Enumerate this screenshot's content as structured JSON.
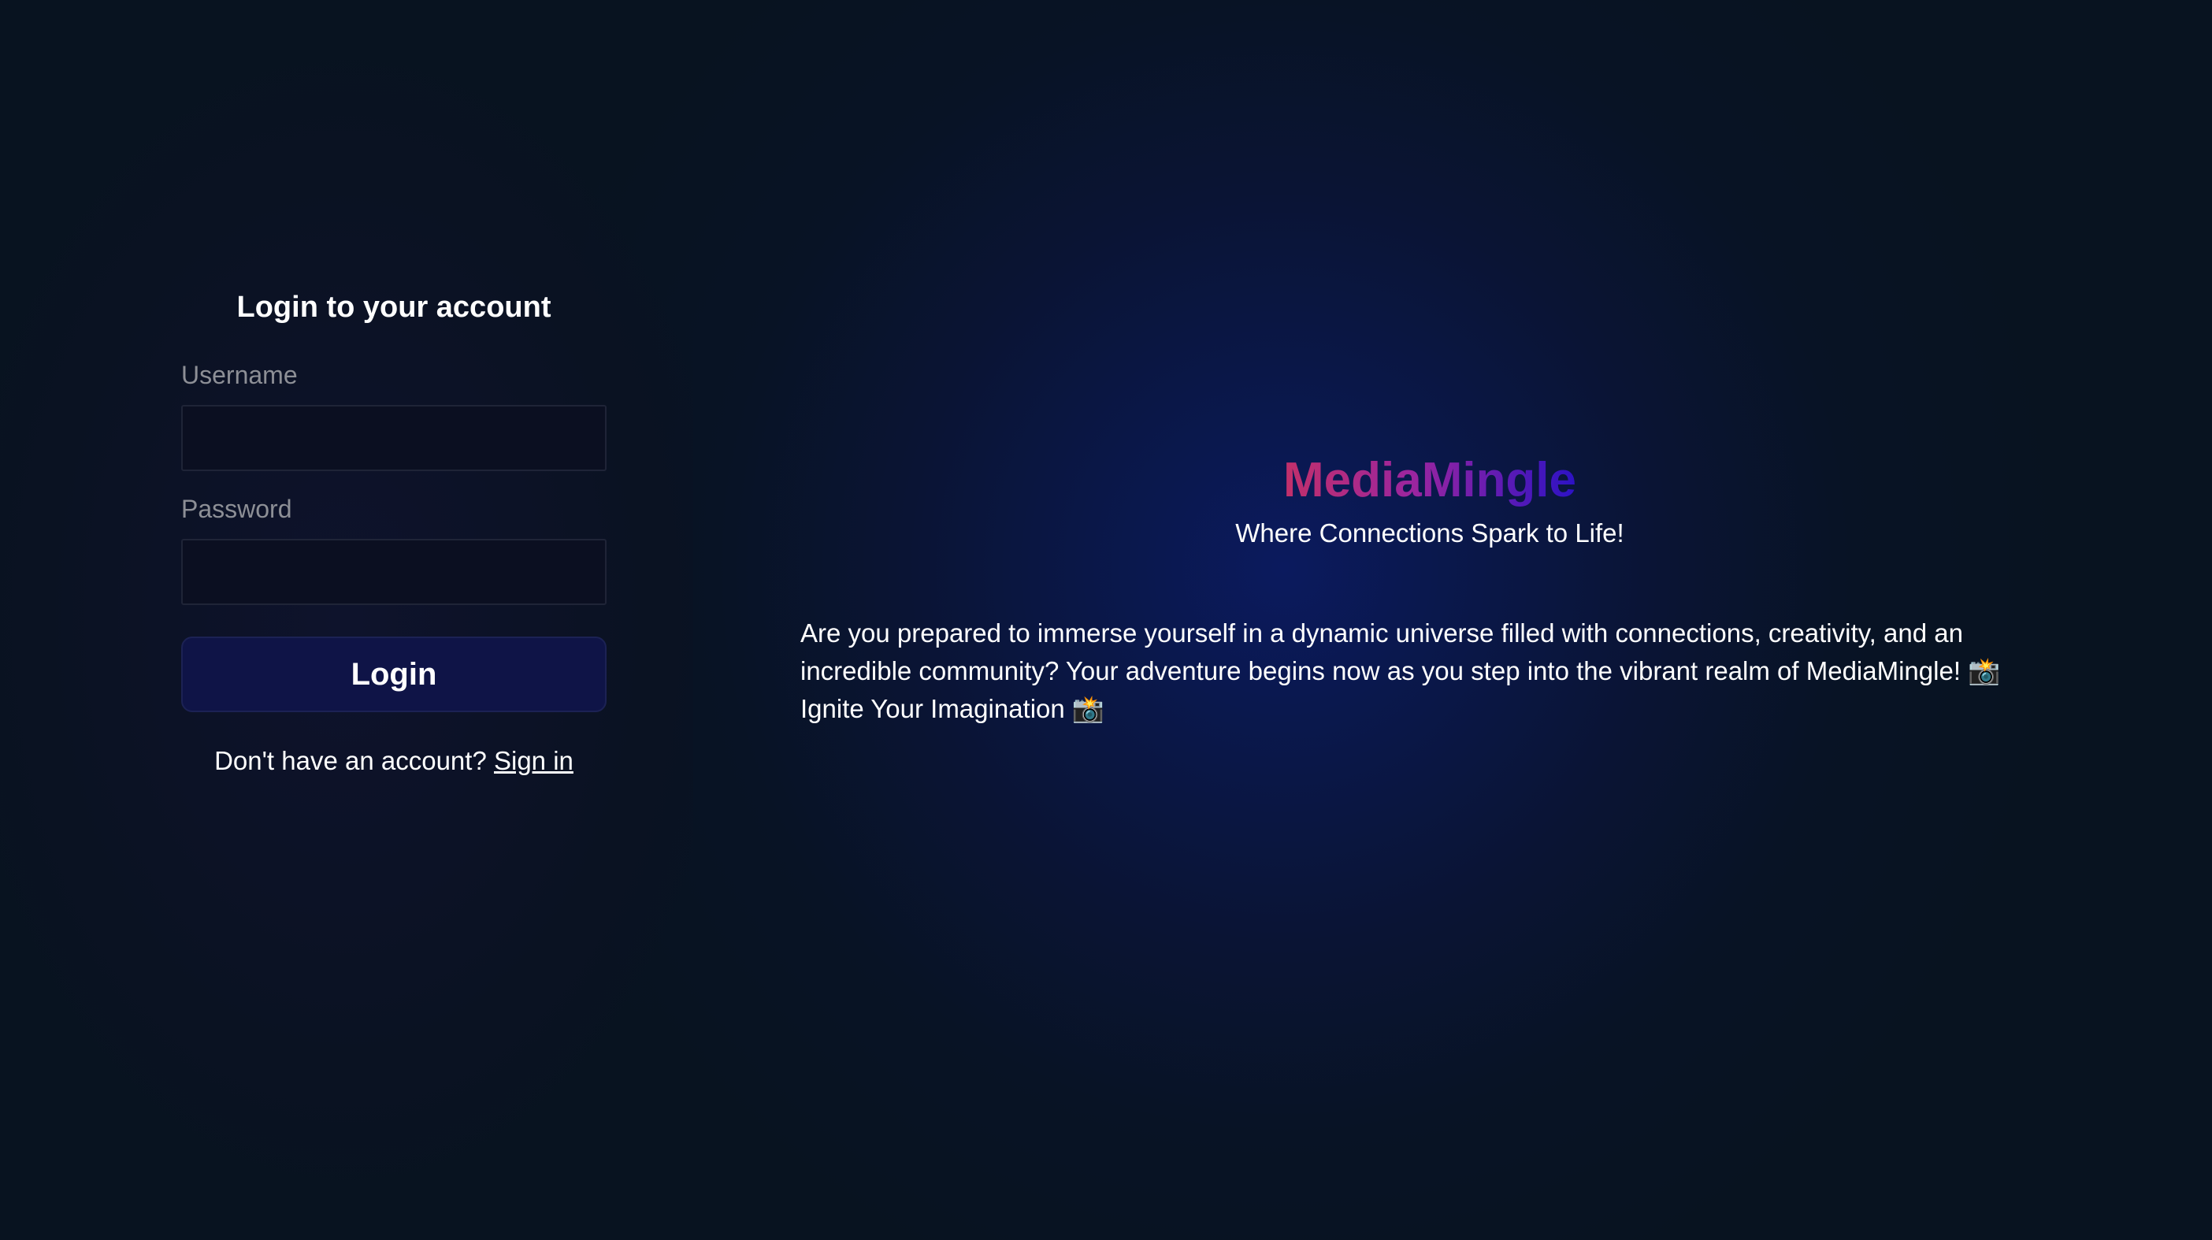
{
  "login": {
    "title": "Login to your account",
    "username_label": "Username",
    "username_value": "",
    "password_label": "Password",
    "password_value": "",
    "submit_label": "Login",
    "signup_prompt": "Don't have an account?",
    "signup_link": "Sign in"
  },
  "hero": {
    "brand": "MediaMingle",
    "tagline": "Where Connections Spark to Life!",
    "description": "Are you prepared to immerse yourself in a dynamic universe filled with connections, creativity, and an incredible community? Your adventure begins now as you step into the vibrant realm of MediaMingle! 📸 Ignite Your Imagination 📸"
  },
  "colors": {
    "background": "#081320",
    "button": "#0f1447",
    "brand_gradient_start": "#c2306a",
    "brand_gradient_end": "#2c12c4"
  }
}
